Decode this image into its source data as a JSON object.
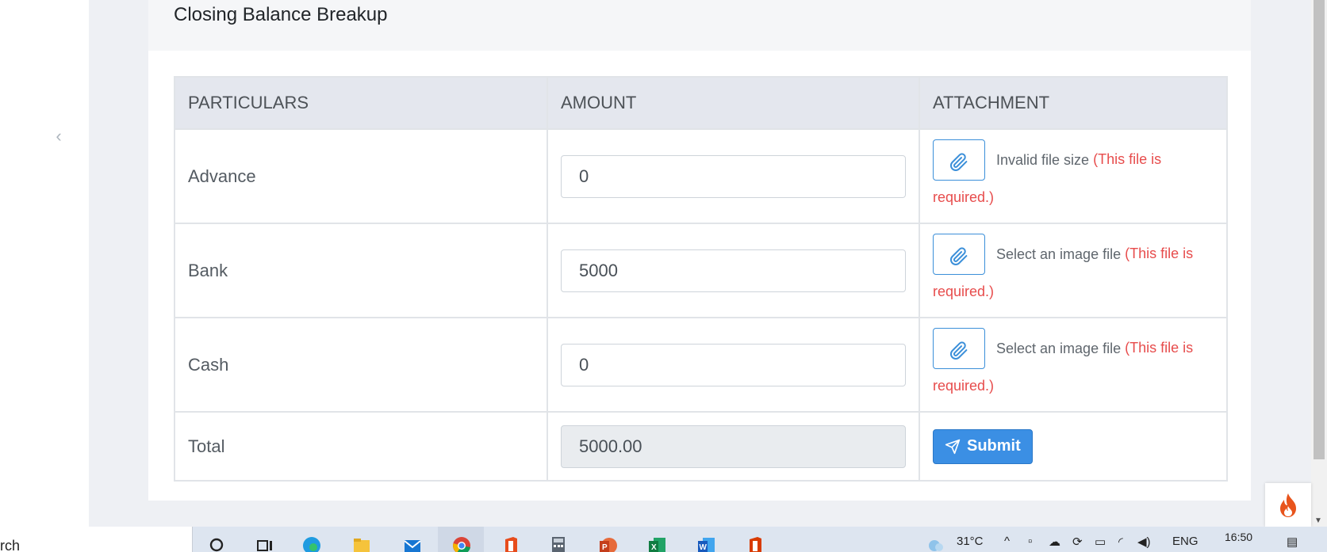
{
  "card": {
    "title": "Closing Balance Breakup"
  },
  "table": {
    "headers": [
      "PARTICULARS",
      "AMOUNT",
      "ATTACHMENT"
    ],
    "rows": [
      {
        "particular": "Advance",
        "amount": "0",
        "file_status": "Invalid file size",
        "required_note": "(This file is required.)"
      },
      {
        "particular": "Bank",
        "amount": "5000",
        "file_status": "Select an image file",
        "required_note": "(This file is required.)"
      },
      {
        "particular": "Cash",
        "amount": "0",
        "file_status": "Select an image file",
        "required_note": "(This file is required.)"
      }
    ],
    "total": {
      "label": "Total",
      "amount": "5000.00",
      "submit_label": "Submit"
    }
  },
  "taskbar": {
    "search_text": "rch",
    "weather": "31°C",
    "language": "ENG",
    "time": "16:50"
  },
  "icons": {
    "sidebar_toggle": "chevron-left-icon",
    "attach": "paperclip-icon",
    "submit": "paper-plane-icon",
    "badge": "fire-icon"
  },
  "colors": {
    "primary": "#3b8fe4",
    "danger": "#e74c4c",
    "header_bg": "#e4e7ee"
  }
}
